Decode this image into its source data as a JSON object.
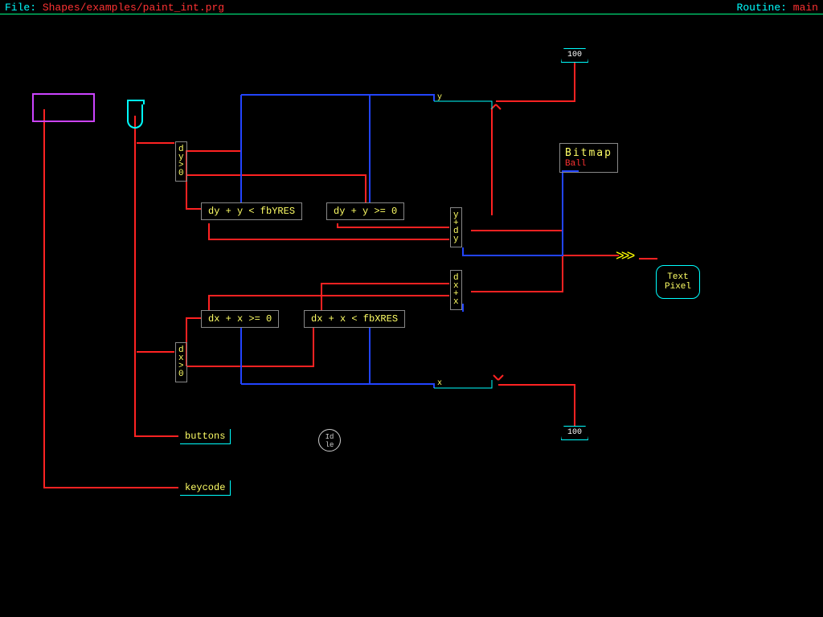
{
  "header": {
    "file_label": "File:",
    "file_path": "Shapes/examples/paint_int.prg",
    "routine_label": "Routine:",
    "routine_name": "main"
  },
  "inputs": {
    "top_const": "100",
    "bottom_const": "100"
  },
  "vars": {
    "y_label": "y",
    "x_label": "x"
  },
  "diamonds": {
    "dy_gt_0": "d\ny\n>\n0",
    "dx_gt_0": "d\nx\n>\n0",
    "y_plus_dy": "y\n+\nd\ny",
    "x_plus_dx": "d\nx\n+\nx"
  },
  "conds": {
    "c1": "dy + y <  fbYRES",
    "c2": "dy + y >= 0",
    "c3": "dx + x >= 0",
    "c4": "dx + x <  fbXRES"
  },
  "outports": {
    "buttons": "buttons",
    "keycode": "keycode"
  },
  "idle": "Id\nle",
  "bitmap": {
    "title": "Bitmap",
    "sub": "Ball"
  },
  "sink": {
    "chevrons": ">>>",
    "text1": "Text",
    "text2": "Pixel"
  }
}
